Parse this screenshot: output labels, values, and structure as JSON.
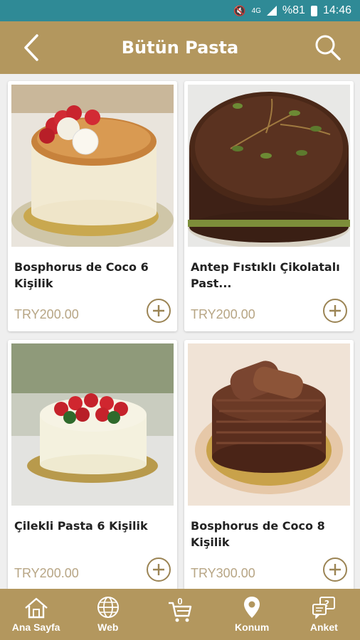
{
  "status_bar": {
    "battery": "%81",
    "time": "14:46",
    "network": "4G"
  },
  "header": {
    "title": "Bütün Pasta"
  },
  "products": [
    {
      "name": "Bosphorus de Coco 6 Kişilik",
      "price": "TRY200.00"
    },
    {
      "name": "Antep Fıstıklı Çikolatalı Past...",
      "price": "TRY200.00"
    },
    {
      "name": "Çilekli Pasta 6 Kişilik",
      "price": "TRY200.00"
    },
    {
      "name": "Bosphorus de Coco 8 Kişilik",
      "price": "TRY300.00"
    }
  ],
  "bottom_nav": {
    "home": "Ana Sayfa",
    "web": "Web",
    "cart_count": "0",
    "location": "Konum",
    "survey": "Anket"
  },
  "colors": {
    "status_bar": "#2f8a96",
    "brand": "#b3975e",
    "price": "#b7a584"
  }
}
